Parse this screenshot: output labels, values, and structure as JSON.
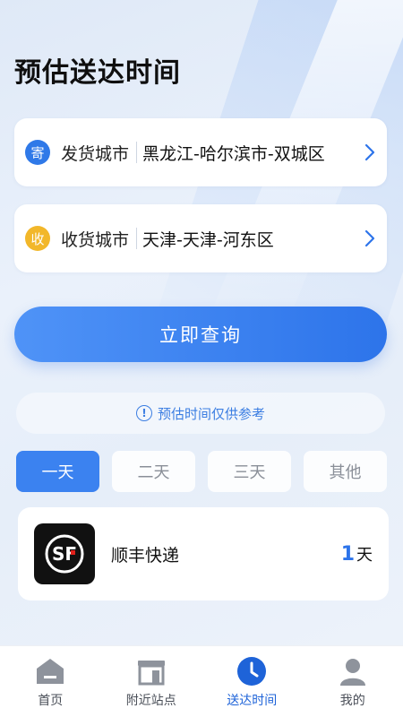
{
  "page": {
    "title": "预估送达时间"
  },
  "send_city": {
    "badge": "寄",
    "label": "发货城市",
    "value": "黑龙江-哈尔滨市-双城区"
  },
  "recv_city": {
    "badge": "收",
    "label": "收货城市",
    "value": "天津-天津-河东区"
  },
  "query_button": "立即查询",
  "notice": "预估时间仅供参考",
  "tabs": [
    "一天",
    "二天",
    "三天",
    "其他"
  ],
  "active_tab": "一天",
  "results": [
    {
      "logo": "sf-express-logo",
      "company": "顺丰快递",
      "days": "1",
      "unit": "天"
    }
  ],
  "tabbar": [
    {
      "icon": "home-icon",
      "label": "首页"
    },
    {
      "icon": "store-icon",
      "label": "附近站点"
    },
    {
      "icon": "clock-icon",
      "label": "送达时间",
      "active": true
    },
    {
      "icon": "user-icon",
      "label": "我的"
    }
  ],
  "colors": {
    "accent": "#2d74ea",
    "badge_send": "#2f79e8",
    "badge_recv": "#f2b72a"
  }
}
